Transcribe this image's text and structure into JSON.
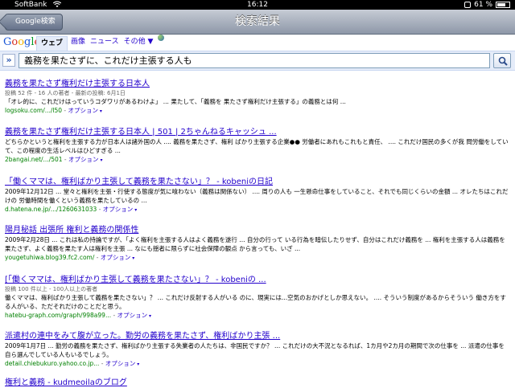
{
  "status": {
    "carrier": "SoftBank",
    "time": "16:12",
    "battery": "61 %"
  },
  "nav": {
    "back_label": "Google検索",
    "title": "検索結果"
  },
  "google": {
    "logo": "Google",
    "tabs": {
      "active": "ウェブ",
      "images": "画像",
      "news": "ニュース",
      "more": "その他 ▼"
    }
  },
  "search": {
    "chevron": "»",
    "query": "義務を果たさずに、これだけ主張する人も"
  },
  "results": [
    {
      "title": "義務を果たさず権利だけ主張する日本人",
      "meta": "投稿 52 件 - 16 人の著者 - 最新の投稿: 6月1日",
      "snippet": "「オレ的に、これだけはっていうコダワリがあるわけよ」 ... 果たして、「義務を 果たさず権利だけ主張する」の義務とは何 ...",
      "url": "logsoku.com/.../l50",
      "option": "オプション"
    },
    {
      "title": "義務を果たさず権利だけ主張する日本人 | 501 | 2ちゃんねるキャッシュ ...",
      "snippet": "どちらかというと権利を主張する力が日本人は諸外国の人 .... 義務を果たさず、権利 ばかり主張する企業●● 労働者にあれもこれもと責任、 .... これだけ国民の多くが我 問労働をしていて、この程度の生活レベルはひどすぎる ...",
      "url": "2bangai.net/.../501",
      "option": "オプション"
    },
    {
      "title": "「働くママは、権利ばかり主張して義務を果たさない」？ - kobeniの日記",
      "snippet": "2009年12月12日 ... 堂々と権利を主張・行使する態度が気に喰わない（義務は関係ない） .... 周りの人も 一生懸命仕事をしていること、それでも同じくらいの金額 ... オレたちはこれだけの 労働時間を働くという義務を果たしているの ...",
      "url": "d.hatena.ne.jp/.../1260631033",
      "option": "オプション"
    },
    {
      "title": "陽月秘話 出張所 権利と義務の関係性",
      "snippet": "2009年2月28日 ... これは私の持論ですが、「よく権利を主張する人はよく義務を遂行 ... 自分の行って いる行為を暗伝したりせず、自分はこれだけ義務を ... 権利を主張する人は義務を 果たさず、よく義務を果たす人は権利を主張 ... なにも揺者に限らずに社会保障の観点 から言っても、いざ ...",
      "url": "yougetuhiwa.blog39.fc2.com/",
      "option": "オプション"
    },
    {
      "title": "[「働くママは、権利ばかり主張して義務を果たさない」？ - kobeniの ...",
      "meta": "投稿 100 件以上 - 100人以上の著者",
      "snippet": "働くママは、権利ばかり主張して義務を果たさない」？ ... これだけ反射する人がいる のに、現実には...空気のおかげとしか思えない。 .... そういう制度があるからそういう 働き方をする人がいる、ただそれだけのことだと思う。",
      "url": "hatebu-graph.com/graph/998a99...",
      "option": "オプション"
    },
    {
      "title": "派遣村の連中をみて腹が立った。勤労の義務を果たさず、権利ばかり主張 ...",
      "snippet": "2009年1月7日 ... 勤労の義務を果たさず、権利ばかり主張する失業者の人たちは、非国民ですか？ ... これだけの大不況となるれば、1カ月や2カ月の期間で次の仕事を ... 派遣の仕事を 自ら選んでしている人もいるでしょう。",
      "url": "detail.chiebukuro.yahoo.co.jp...",
      "option": "オプション"
    },
    {
      "title": "権利と義務 - kudmeoilaのブログ"
    }
  ]
}
